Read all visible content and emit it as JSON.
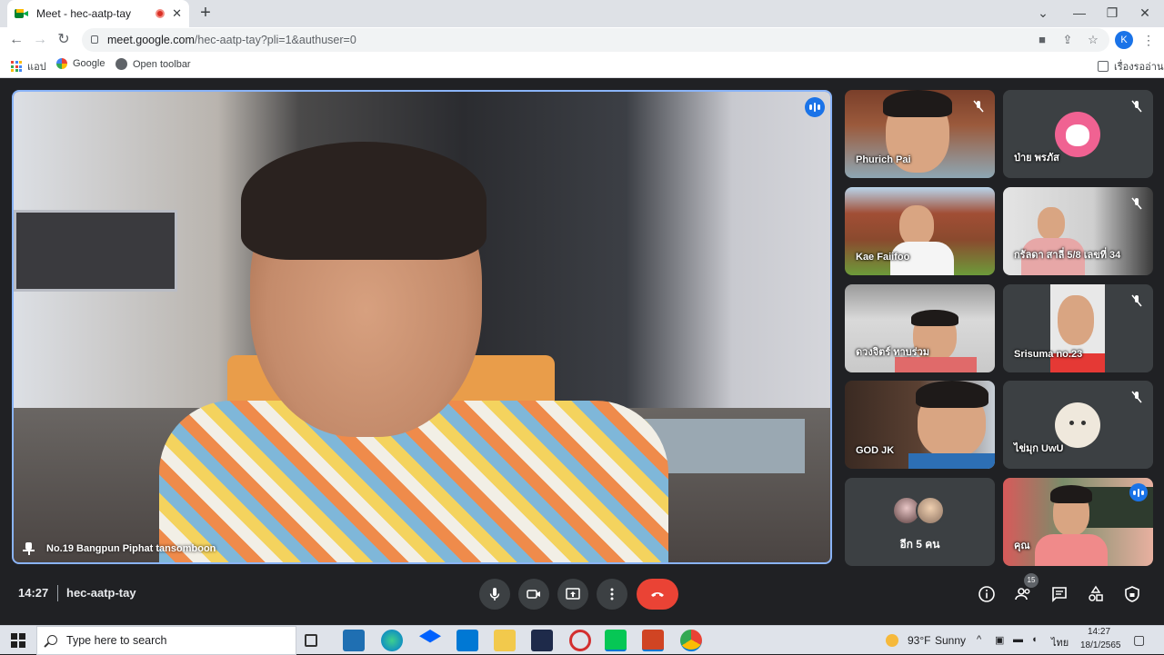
{
  "browser": {
    "tab_title": "Meet - hec-aatp-tay",
    "tab_close": "✕",
    "new_tab": "+",
    "url_host": "meet.google.com",
    "url_path": "/hec-aatp-tay?pli=1&authuser=0",
    "profile_initial": "K",
    "bookmarks": {
      "apps_label": "แอป",
      "google_label": "Google",
      "open_toolbar_label": "Open toolbar",
      "reading_list_label": "เรื่องรออ่าน"
    }
  },
  "meet": {
    "main_speaker": "No.19 Bangpun Piphat tansomboon",
    "participants": [
      {
        "name": "Phurich Pai",
        "muted": true,
        "video": true
      },
      {
        "name": "ป่าย พรภัส",
        "muted": true,
        "video": false,
        "avatar": "pink-cow-avatar"
      },
      {
        "name": "Kae Faiifoo",
        "muted": false,
        "video": true
      },
      {
        "name": "กรัลดา สาลี่ 5/8 เลขที่ 34",
        "muted": true,
        "video": true
      },
      {
        "name": "ดวงจิตร์ ทาบร่วม",
        "muted": false,
        "video": true
      },
      {
        "name": "Srisuma no.23",
        "muted": true,
        "video": true
      },
      {
        "name": "GOD JK",
        "muted": false,
        "video": true
      },
      {
        "name": "ไข่มุก UwU",
        "muted": true,
        "video": false,
        "avatar": "white-pet-avatar"
      },
      {
        "name": "อีก 5 คน",
        "muted": false,
        "video": false
      },
      {
        "name": "คุณ",
        "muted": false,
        "video": true,
        "speaking": true
      }
    ],
    "time": "14:27",
    "meeting_code": "hec-aatp-tay",
    "participant_count": "15"
  },
  "taskbar": {
    "search_placeholder": "Type here to search",
    "weather_temp": "93°F",
    "weather_text": "Sunny",
    "language": "ไทย",
    "clock_time": "14:27",
    "clock_date": "18/1/2565"
  },
  "colors": {
    "meet_bg": "#202124",
    "active_border": "#8ab4f8",
    "hangup": "#ea4335",
    "speaking": "#1a73e8"
  }
}
